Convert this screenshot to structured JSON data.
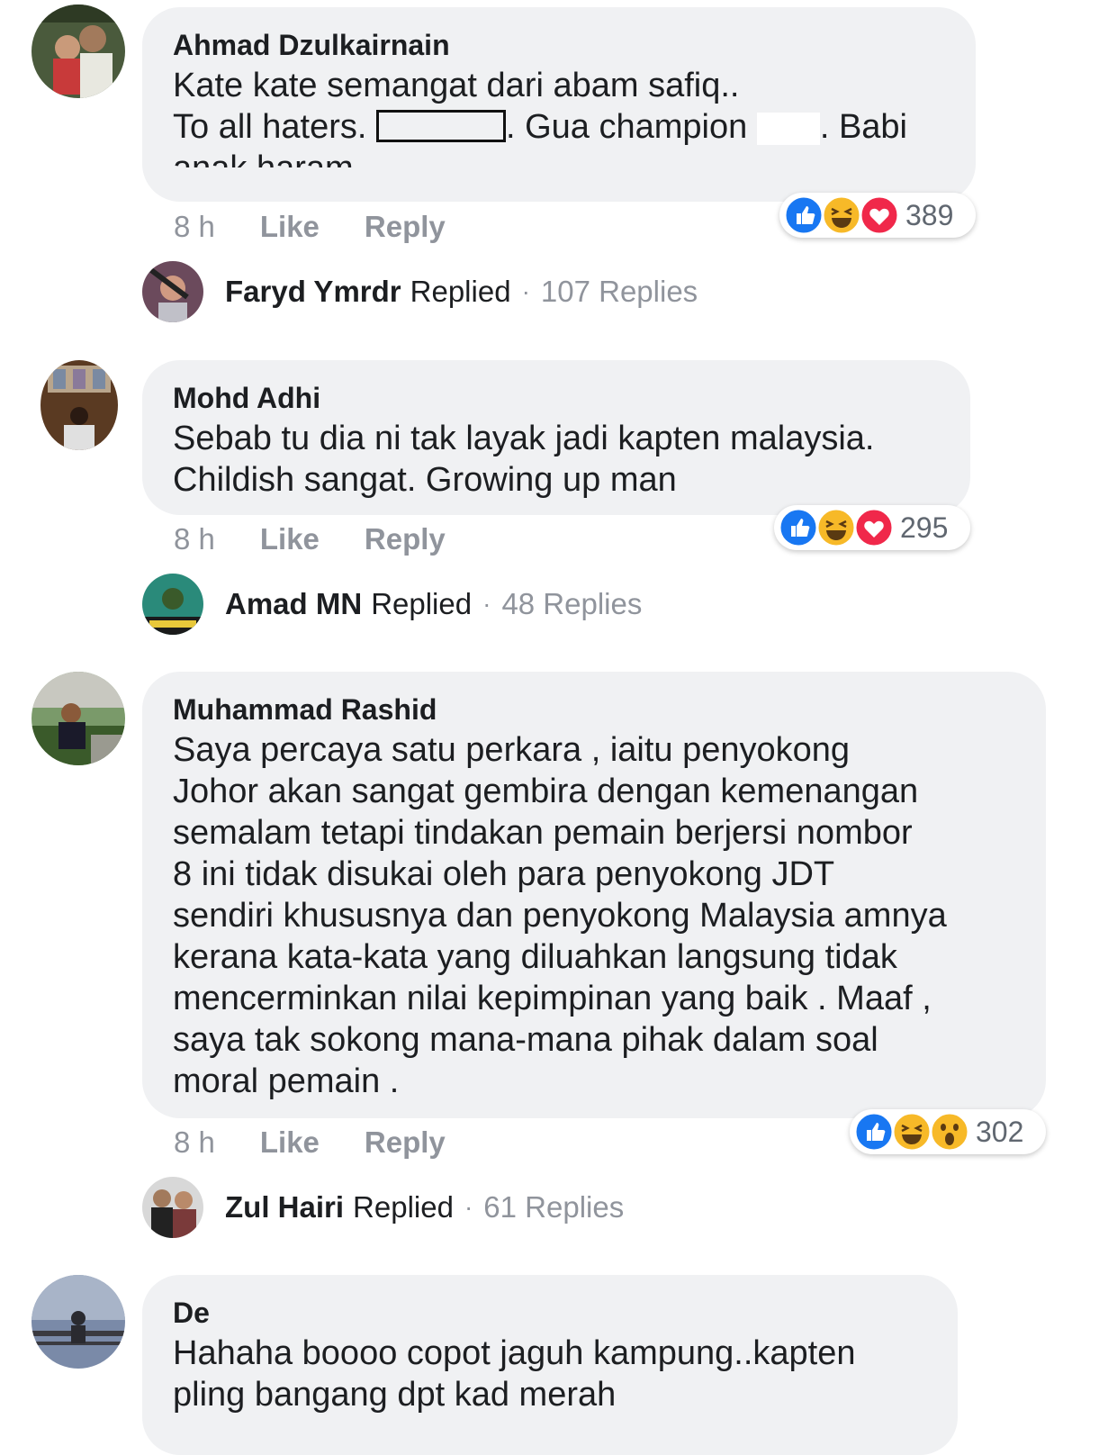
{
  "comments": [
    {
      "author": "Ahmad Dzulkairnain",
      "line1": "Kate kate semangat dari abam safiq..",
      "line2_pre": "To all haters. ",
      "line2_mid": ". Gua champion ",
      "line2_post": ". Babi",
      "line3": "anak haram",
      "time": "8 h",
      "like": "Like",
      "reply": "Reply",
      "reaction_count": "389",
      "reactions": [
        "like-icon",
        "haha-icon",
        "love-icon"
      ],
      "replier": "Faryd Ymrdr",
      "replied": "Replied",
      "reply_count": "107 Replies"
    },
    {
      "author": "Mohd Adhi",
      "text": "Sebab tu dia ni tak layak jadi kapten malaysia.\nChildish sangat. Growing up man",
      "time": "8 h",
      "like": "Like",
      "reply": "Reply",
      "reaction_count": "295",
      "reactions": [
        "like-icon",
        "haha-icon",
        "love-icon"
      ],
      "replier": "Amad MN",
      "replied": "Replied",
      "reply_count": "48 Replies"
    },
    {
      "author": "Muhammad Rashid",
      "text": "Saya percaya satu perkara , iaitu penyokong\nJohor akan sangat gembira dengan kemenangan\nsemalam tetapi tindakan pemain berjersi nombor\n8 ini tidak disukai oleh para penyokong JDT\nsendiri khususnya dan penyokong Malaysia amnya\nkerana kata-kata yang diluahkan langsung tidak\nmencerminkan nilai kepimpinan yang baik . Maaf ,\nsaya tak sokong mana-mana pihak dalam soal\nmoral pemain .",
      "time": "8 h",
      "like": "Like",
      "reply": "Reply",
      "reaction_count": "302",
      "reactions": [
        "like-icon",
        "haha-icon",
        "wow-icon"
      ],
      "replier": "Zul Hairi",
      "replied": "Replied",
      "reply_count": "61 Replies"
    },
    {
      "author": "De",
      "text": "Hahaha boooo copot jaguh kampung..kapten\npling bangang dpt kad merah"
    }
  ],
  "colors": {
    "bubble": "#f0f1f3",
    "like_blue": "#1877f2",
    "love_red": "#f0284a",
    "haha_yellow": "#f7b928",
    "meta_gray": "#90949c"
  },
  "separator": "·"
}
